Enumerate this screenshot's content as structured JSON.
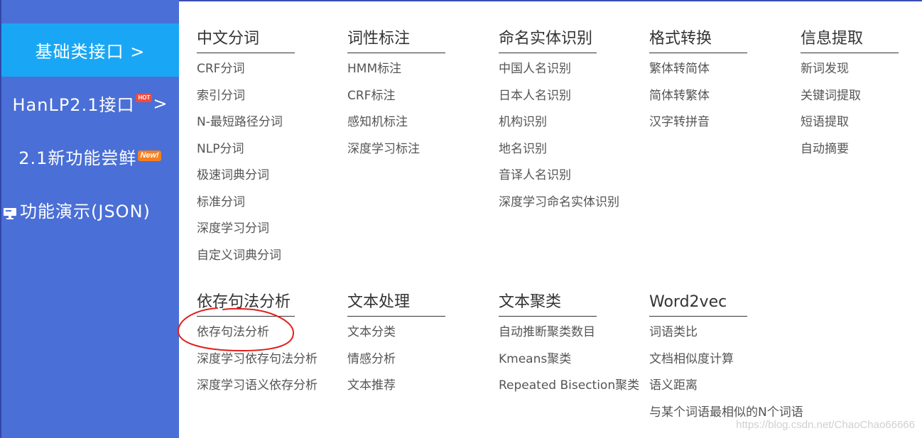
{
  "sidebar": {
    "items": [
      {
        "label": "基础类接口 >"
      },
      {
        "label": "HanLP2.1接口",
        "badge": "HOT",
        "suffix": ">"
      },
      {
        "label": "2.1新功能尝鲜",
        "badge": "New!"
      },
      {
        "label": "功能演示(JSON)",
        "icon": "monitor-icon"
      }
    ]
  },
  "menu": {
    "row1": [
      {
        "title": "中文分词",
        "links": [
          "CRF分词",
          "索引分词",
          "N-最短路径分词",
          "NLP分词",
          "极速词典分词",
          "标准分词",
          "深度学习分词",
          "自定义词典分词"
        ]
      },
      {
        "title": "词性标注",
        "links": [
          "HMM标注",
          "CRF标注",
          "感知机标注",
          "深度学习标注"
        ]
      },
      {
        "title": "命名实体识别",
        "links": [
          "中国人名识别",
          "日本人名识别",
          "机构识别",
          "地名识别",
          "音译人名识别",
          "深度学习命名实体识别"
        ]
      },
      {
        "title": "格式转换",
        "links": [
          "繁体转简体",
          "简体转繁体",
          "汉字转拼音"
        ]
      },
      {
        "title": "信息提取",
        "links": [
          "新词发现",
          "关键词提取",
          "短语提取",
          "自动摘要"
        ]
      }
    ],
    "row2": [
      {
        "title": "依存句法分析",
        "links": [
          "依存句法分析",
          "深度学习依存句法分析",
          "深度学习语义依存分析"
        ]
      },
      {
        "title": "文本处理",
        "links": [
          "文本分类",
          "情感分析",
          "文本推荐"
        ]
      },
      {
        "title": "文本聚类",
        "links": [
          "自动推断聚类数目",
          "Kmeans聚类",
          "Repeated Bisection聚类"
        ]
      },
      {
        "title": "Word2vec",
        "links": [
          "词语类比",
          "文档相似度计算",
          "语义距离",
          "与某个词语最相似的N个词语"
        ]
      }
    ]
  },
  "watermark": "https://blog.csdn.net/ChaoChao66666",
  "colors": {
    "sidebar_bg": "#4a6fd6",
    "sidebar_active": "#19a7f5",
    "annotation_red": "#e0201c"
  }
}
